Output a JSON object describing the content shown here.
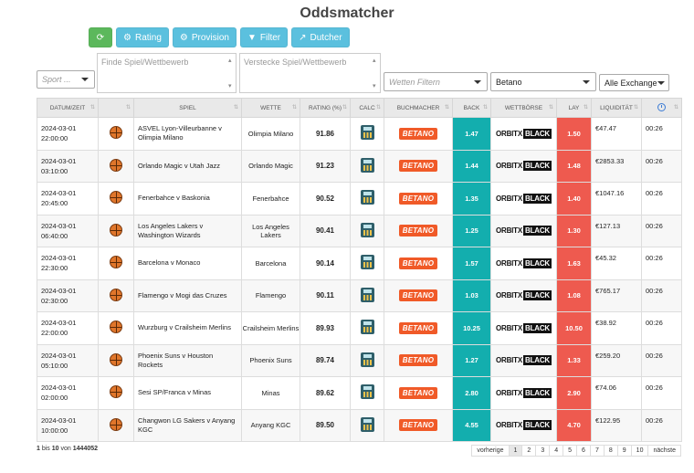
{
  "title": "Oddsmatcher",
  "toolbar": {
    "rating": "Rating",
    "provision": "Provision",
    "filter": "Filter",
    "dutcher": "Dutcher"
  },
  "filters": {
    "sport_placeholder": "Sport ...",
    "find_placeholder": "Finde Spiel/Wettbewerb",
    "hide_placeholder": "Verstecke Spiel/Wettbewerb",
    "bets_placeholder": "Wetten Filtern",
    "bookmaker": "Betano",
    "exchange": "Alle Exchange"
  },
  "columns": [
    "DATUM/ZEIT",
    "",
    "SPIEL",
    "WETTE",
    "RATING (%)",
    "CALC",
    "BUCHMACHER",
    "BACK",
    "WETTBÖRSE",
    "LAY",
    "LIQUIDITÄT",
    ""
  ],
  "bookmaker_logo": "BETANO",
  "exchange_logo": {
    "part1": "ORBITX",
    "part2": "BLACK"
  },
  "rows": [
    {
      "date": "2024-03-01",
      "time": "22:00:00",
      "game": "ASVEL Lyon-Villeurbanne v Olimpia Milano",
      "bet": "Olimpia Milano",
      "rating": "91.86",
      "back": "1.47",
      "lay": "1.50",
      "liq": "€47.47",
      "age": "00:26"
    },
    {
      "date": "2024-03-01",
      "time": "03:10:00",
      "game": "Orlando Magic v Utah Jazz",
      "bet": "Orlando Magic",
      "rating": "91.23",
      "back": "1.44",
      "lay": "1.48",
      "liq": "€2853.33",
      "age": "00:26"
    },
    {
      "date": "2024-03-01",
      "time": "20:45:00",
      "game": "Fenerbahce v Baskonia",
      "bet": "Fenerbahce",
      "rating": "90.52",
      "back": "1.35",
      "lay": "1.40",
      "liq": "€1047.16",
      "age": "00:26"
    },
    {
      "date": "2024-03-01",
      "time": "06:40:00",
      "game": "Los Angeles Lakers v Washington Wizards",
      "bet": "Los Angeles Lakers",
      "rating": "90.41",
      "back": "1.25",
      "lay": "1.30",
      "liq": "€127.13",
      "age": "00:26"
    },
    {
      "date": "2024-03-01",
      "time": "22:30:00",
      "game": "Barcelona v Monaco",
      "bet": "Barcelona",
      "rating": "90.14",
      "back": "1.57",
      "lay": "1.63",
      "liq": "€45.32",
      "age": "00:26"
    },
    {
      "date": "2024-03-01",
      "time": "02:30:00",
      "game": "Flamengo v Mogi das Cruzes",
      "bet": "Flamengo",
      "rating": "90.11",
      "back": "1.03",
      "lay": "1.08",
      "liq": "€765.17",
      "age": "00:26"
    },
    {
      "date": "2024-03-01",
      "time": "22:00:00",
      "game": "Wurzburg v Crailsheim Merlins",
      "bet": "Crailsheim Merlins",
      "rating": "89.93",
      "back": "10.25",
      "lay": "10.50",
      "liq": "€38.92",
      "age": "00:26"
    },
    {
      "date": "2024-03-01",
      "time": "05:10:00",
      "game": "Phoenix Suns v Houston Rockets",
      "bet": "Phoenix Suns",
      "rating": "89.74",
      "back": "1.27",
      "lay": "1.33",
      "liq": "€259.20",
      "age": "00:26"
    },
    {
      "date": "2024-03-01",
      "time": "02:00:00",
      "game": "Sesi SP/Franca v Minas",
      "bet": "Minas",
      "rating": "89.62",
      "back": "2.80",
      "lay": "2.90",
      "liq": "€74.06",
      "age": "00:26"
    },
    {
      "date": "2024-03-01",
      "time": "10:00:00",
      "game": "Changwon LG Sakers v Anyang KGC",
      "bet": "Anyang KGC",
      "rating": "89.50",
      "back": "4.55",
      "lay": "4.70",
      "liq": "€122.95",
      "age": "00:26"
    }
  ],
  "footer": {
    "from": "1",
    "bis": "bis",
    "to": "10",
    "von": "von",
    "total": "1444052"
  },
  "pager": {
    "prev": "vorherige",
    "pages": [
      "1",
      "2",
      "3",
      "4",
      "5",
      "6",
      "7",
      "8",
      "9",
      "10"
    ],
    "next": "nächste"
  },
  "colors": {
    "back": "#13aeae",
    "lay": "#ee5a4f",
    "green": "#5cb85c",
    "blue": "#5bc0de"
  }
}
